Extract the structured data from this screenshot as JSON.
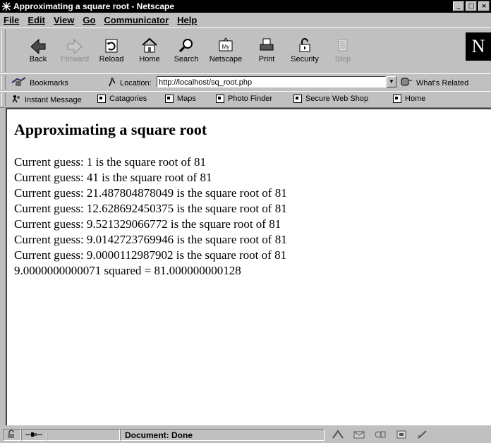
{
  "window": {
    "title": "Approximating a square root - Netscape",
    "controls": [
      "_",
      "□",
      "×"
    ]
  },
  "menu": [
    {
      "label": "File",
      "key": "F"
    },
    {
      "label": "Edit",
      "key": "E"
    },
    {
      "label": "View",
      "key": "V"
    },
    {
      "label": "Go",
      "key": "G"
    },
    {
      "label": "Communicator",
      "key": "C"
    },
    {
      "label": "Help",
      "key": "H"
    }
  ],
  "nav_toolbar": {
    "buttons": [
      {
        "label": "Back",
        "icon": "back-arrow-icon",
        "enabled": true
      },
      {
        "label": "Forward",
        "icon": "forward-arrow-icon",
        "enabled": false
      },
      {
        "label": "Reload",
        "icon": "reload-icon",
        "enabled": true
      },
      {
        "label": "Home",
        "icon": "home-icon",
        "enabled": true
      },
      {
        "label": "Search",
        "icon": "search-icon",
        "enabled": true
      },
      {
        "label": "Netscape",
        "icon": "netscape-icon",
        "enabled": true
      },
      {
        "label": "Print",
        "icon": "print-icon",
        "enabled": true
      },
      {
        "label": "Security",
        "icon": "lock-icon",
        "enabled": true
      },
      {
        "label": "Stop",
        "icon": "stop-icon",
        "enabled": false
      }
    ],
    "logo": "N"
  },
  "location_toolbar": {
    "bookmarks_label": "Bookmarks",
    "location_label": "Location:",
    "url": "http://localhost/sq_root.php",
    "whats_related": "What's Related"
  },
  "personal_toolbar": {
    "items": [
      "Instant Message",
      "Catagories",
      "Maps",
      "Photo Finder",
      "Secure Web Shop",
      "Home"
    ]
  },
  "page": {
    "heading": "Approximating a square root",
    "lines": [
      "Current guess: 1 is the square root of 81",
      "Current guess: 41 is the square root of 81",
      "Current guess: 21.487804878049 is the square root of 81",
      "Current guess: 12.628692450375 is the square root of 81",
      "Current guess: 9.521329066772 is the square root of 81",
      "Current guess: 9.0142723769946 is the square root of 81",
      "Current guess: 9.0000112987902 is the square root of 81",
      "9.0000000000071 squared = 81.000000000128"
    ]
  },
  "status": {
    "text": "Document: Done"
  }
}
